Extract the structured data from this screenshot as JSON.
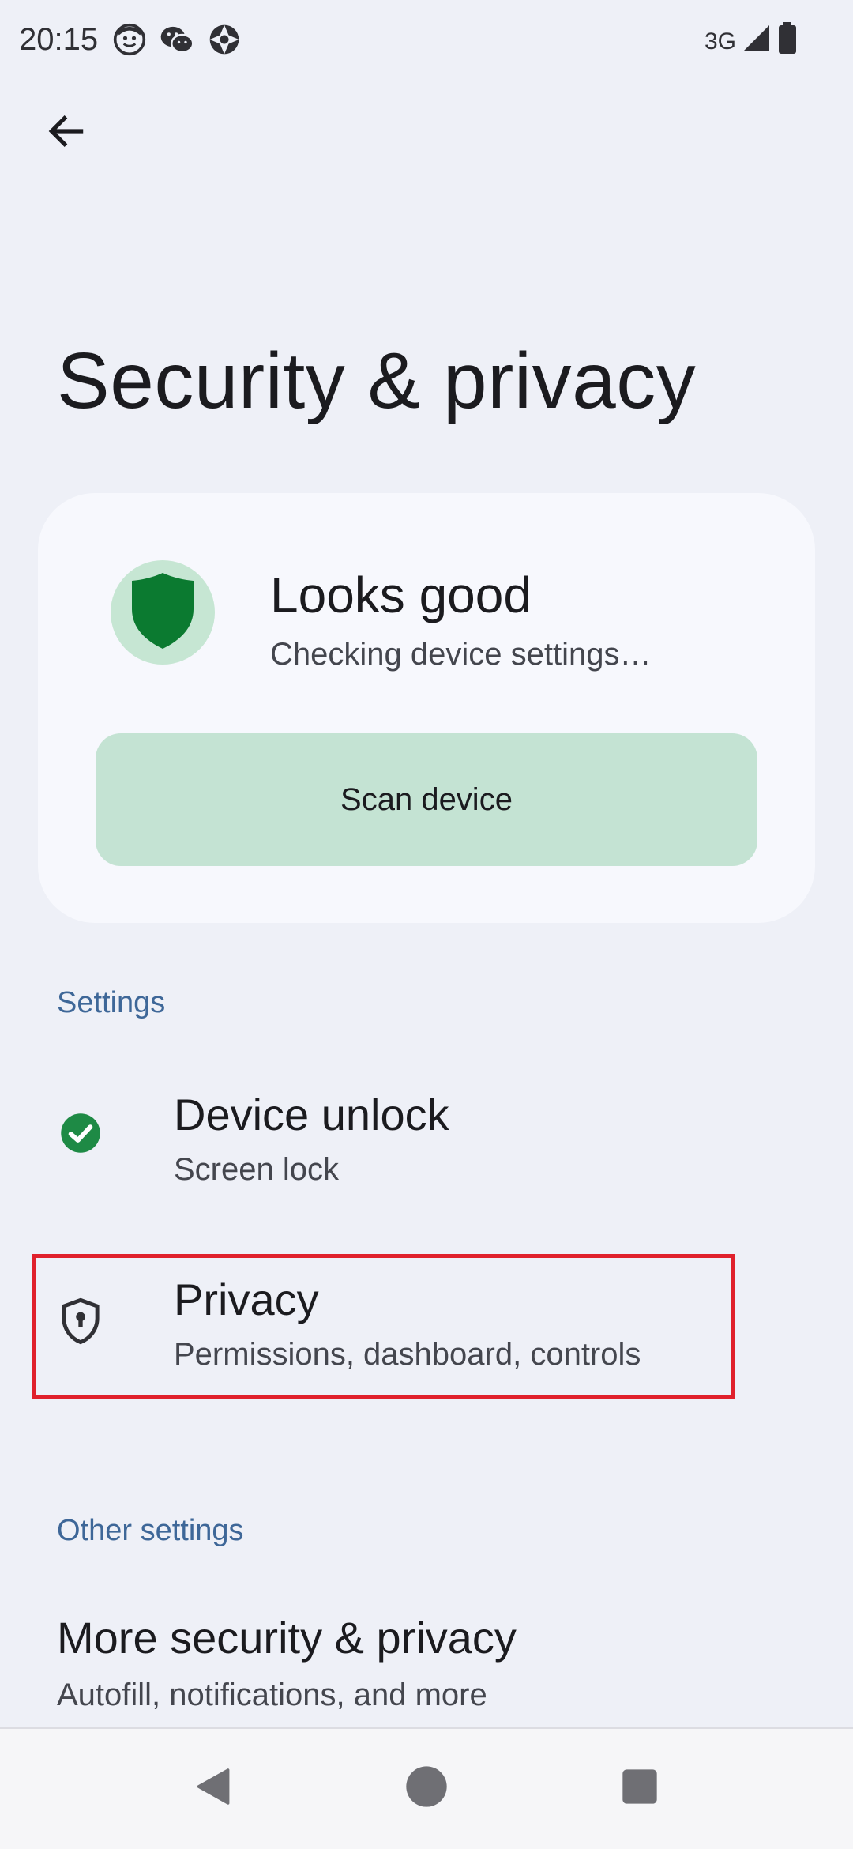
{
  "status_bar": {
    "time": "20:15",
    "network": "3G",
    "icons": [
      "face-icon",
      "wechat-icon",
      "aperture-icon",
      "signal-icon",
      "battery-icon"
    ]
  },
  "header": {
    "back_icon": "arrow-left-icon",
    "title": "Security & privacy"
  },
  "status_card": {
    "icon": "shield-icon",
    "title": "Looks good",
    "subtitle": "Checking device settings…",
    "button_label": "Scan device",
    "colors": {
      "shield": "#0b7a30",
      "shield_bg": "#c6e6d3",
      "button_bg": "#c4e3d3"
    }
  },
  "sections": {
    "settings_header": "Settings",
    "other_header": "Other settings"
  },
  "items": [
    {
      "icon": "check-circle-icon",
      "title": "Device unlock",
      "subtitle": "Screen lock"
    },
    {
      "icon": "shield-lock-icon",
      "title": "Privacy",
      "subtitle": "Permissions, dashboard, controls"
    }
  ],
  "more": {
    "title": "More security & privacy",
    "subtitle": "Autofill, notifications, and more"
  },
  "nav": [
    "back-triangle-icon",
    "home-circle-icon",
    "recents-square-icon"
  ],
  "accent": "#3e6798",
  "highlight_color": "#e0202c"
}
